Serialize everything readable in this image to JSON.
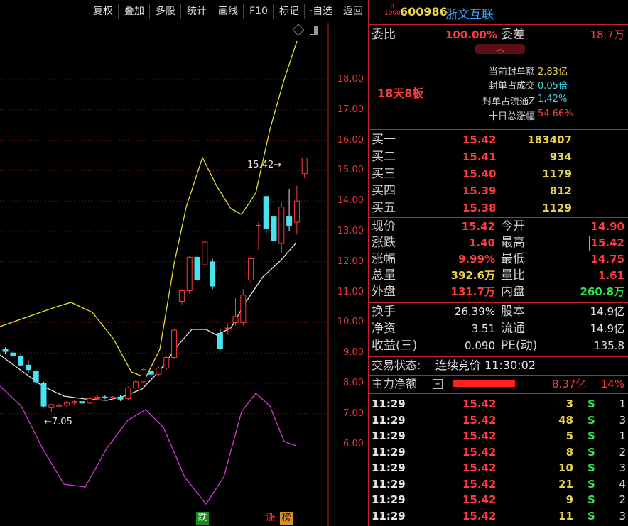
{
  "toolbar": {
    "buttons": [
      "复权",
      "叠加",
      "多股",
      "统计",
      "画线",
      "F10",
      "标记",
      "·自选",
      "返回"
    ]
  },
  "chart": {
    "price_ticks": [
      "18.00",
      "17.00",
      "16.00",
      "15.00",
      "14.00",
      "13.00",
      "12.00",
      "11.00",
      "10.00",
      "9.00",
      "8.00",
      "7.00",
      "6.00"
    ],
    "high_label": "15.42",
    "low_label": "7.05",
    "markers": {
      "down": "跌",
      "up": "涨",
      "rank": "榜"
    }
  },
  "header": {
    "badge_top": "R",
    "badge_bottom": "1000",
    "code": "600986",
    "name": "浙文互联"
  },
  "weibi": {
    "label1": "委比",
    "value1": "100.00%",
    "label2": "委差",
    "value2": "18.7万"
  },
  "seal": {
    "streak": "18天8板",
    "rows": [
      {
        "label": "当前封单额",
        "value": "2.83亿",
        "color": "yel"
      },
      {
        "label": "封单占成交",
        "value": "0.05倍",
        "color": "cyan"
      },
      {
        "label": "封单占流通Z",
        "value": "1.42%",
        "color": "cyan"
      },
      {
        "label": "十日总涨幅",
        "value": "54.66%",
        "color": "red"
      }
    ]
  },
  "bids": [
    {
      "label": "买一",
      "price": "15.42",
      "vol": "183407"
    },
    {
      "label": "买二",
      "price": "15.41",
      "vol": "934"
    },
    {
      "label": "买三",
      "price": "15.40",
      "vol": "1179"
    },
    {
      "label": "买四",
      "price": "15.39",
      "vol": "812"
    },
    {
      "label": "买五",
      "price": "15.38",
      "vol": "1129"
    }
  ],
  "quote": {
    "rows": [
      {
        "l1": "现价",
        "v1": "15.42",
        "c1": "red",
        "l2": "今开",
        "v2": "14.90",
        "c2": "red"
      },
      {
        "l1": "涨跌",
        "v1": "1.40",
        "c1": "red",
        "l2": "最高",
        "v2": "15.42",
        "c2": "red"
      },
      {
        "l1": "涨幅",
        "v1": "9.99%",
        "c1": "red",
        "l2": "最低",
        "v2": "14.75",
        "c2": "red"
      },
      {
        "l1": "总量",
        "v1": "392.6万",
        "c1": "yel",
        "l2": "量比",
        "v2": "1.61",
        "c2": "red"
      },
      {
        "l1": "外盘",
        "v1": "131.7万",
        "c1": "red",
        "l2": "内盘",
        "v2": "260.8万",
        "c2": "grn"
      }
    ]
  },
  "fund": {
    "rows": [
      {
        "l1": "换手",
        "v1": "26.39%",
        "l2": "股本",
        "v2": "14.9亿"
      },
      {
        "l1": "净资",
        "v1": "3.51",
        "l2": "流通",
        "v2": "14.9亿"
      },
      {
        "l1": "收益(三)",
        "v1": "0.090",
        "l2": "PE(动)",
        "v2": "135.8"
      }
    ]
  },
  "trade_status": {
    "label": "交易状态:",
    "value": "连续竞价 11:30:02"
  },
  "main_flow": {
    "label": "主力净额",
    "value": "8.37亿",
    "pct": "14%"
  },
  "ticks": [
    {
      "time": "11:29",
      "price": "15.42",
      "vol": "3",
      "side": "S",
      "n": "1"
    },
    {
      "time": "11:29",
      "price": "15.42",
      "vol": "48",
      "side": "S",
      "n": "3"
    },
    {
      "time": "11:29",
      "price": "15.42",
      "vol": "5",
      "side": "S",
      "n": "1"
    },
    {
      "time": "11:29",
      "price": "15.42",
      "vol": "8",
      "side": "S",
      "n": "2"
    },
    {
      "time": "11:29",
      "price": "15.42",
      "vol": "10",
      "side": "S",
      "n": "3"
    },
    {
      "time": "11:29",
      "price": "15.42",
      "vol": "21",
      "side": "S",
      "n": "4"
    },
    {
      "time": "11:29",
      "price": "15.42",
      "vol": "9",
      "side": "S",
      "n": "2"
    },
    {
      "time": "11:29",
      "price": "15.42",
      "vol": "11",
      "side": "S",
      "n": "3"
    }
  ],
  "candles": [
    {
      "o": 9.12,
      "c": 9.05,
      "h": 9.18,
      "l": 8.98
    },
    {
      "o": 9.0,
      "c": 8.92,
      "h": 9.05,
      "l": 8.85
    },
    {
      "o": 8.9,
      "c": 8.6,
      "h": 8.95,
      "l": 8.55
    },
    {
      "o": 8.6,
      "c": 8.45,
      "h": 8.75,
      "l": 8.35
    },
    {
      "o": 8.4,
      "c": 8.05,
      "h": 8.45,
      "l": 7.95
    },
    {
      "o": 8.0,
      "c": 7.25,
      "h": 8.05,
      "l": 7.2
    },
    {
      "o": 7.2,
      "c": 7.3,
      "h": 7.32,
      "l": 7.05
    },
    {
      "o": 7.25,
      "c": 7.28,
      "h": 7.33,
      "l": 7.2
    },
    {
      "o": 7.28,
      "c": 7.35,
      "h": 7.42,
      "l": 7.22
    },
    {
      "o": 7.35,
      "c": 7.4,
      "h": 7.45,
      "l": 7.3
    },
    {
      "o": 7.4,
      "c": 7.35,
      "h": 7.45,
      "l": 7.28
    },
    {
      "o": 7.35,
      "c": 7.5,
      "h": 7.55,
      "l": 7.3
    },
    {
      "o": 7.5,
      "c": 7.55,
      "h": 7.6,
      "l": 7.45
    },
    {
      "o": 7.55,
      "c": 7.52,
      "h": 7.6,
      "l": 7.48
    },
    {
      "o": 7.52,
      "c": 7.55,
      "h": 7.58,
      "l": 7.48
    },
    {
      "o": 7.55,
      "c": 7.48,
      "h": 7.6,
      "l": 7.42
    },
    {
      "o": 7.5,
      "c": 7.85,
      "h": 7.9,
      "l": 7.45
    },
    {
      "o": 7.85,
      "c": 8.05,
      "h": 8.1,
      "l": 7.8
    },
    {
      "o": 8.05,
      "c": 8.45,
      "h": 8.5,
      "l": 8.0
    },
    {
      "o": 8.4,
      "c": 8.3,
      "h": 8.45,
      "l": 8.25
    },
    {
      "o": 8.3,
      "c": 8.5,
      "h": 8.55,
      "l": 8.25
    },
    {
      "o": 8.5,
      "c": 8.85,
      "h": 8.9,
      "l": 8.45
    },
    {
      "o": 8.85,
      "c": 9.75,
      "h": 9.8,
      "l": 8.8
    },
    {
      "o": 10.7,
      "c": 11.05,
      "h": 11.1,
      "l": 10.6
    },
    {
      "o": 11.05,
      "c": 12.15,
      "h": 12.2,
      "l": 10.95
    },
    {
      "o": 12.15,
      "c": 11.4,
      "h": 12.2,
      "l": 11.2
    },
    {
      "o": 11.9,
      "c": 12.65,
      "h": 12.7,
      "l": 11.8
    },
    {
      "o": 12.0,
      "c": 11.2,
      "h": 12.1,
      "l": 11.1
    },
    {
      "o": 9.65,
      "c": 9.15,
      "h": 9.8,
      "l": 9.1
    },
    {
      "o": 9.82,
      "c": 9.82,
      "h": 9.95,
      "l": 9.6
    },
    {
      "o": 10.0,
      "c": 10.2,
      "h": 10.8,
      "l": 9.9
    },
    {
      "o": 10.0,
      "c": 10.9,
      "h": 11.1,
      "l": 9.9
    },
    {
      "o": 11.4,
      "c": 12.1,
      "h": 12.2,
      "l": 11.3
    },
    {
      "o": 13.2,
      "c": 13.2,
      "h": 13.3,
      "l": 12.4
    },
    {
      "o": 14.15,
      "c": 13.1,
      "h": 14.2,
      "l": 12.9
    },
    {
      "o": 13.5,
      "c": 12.7,
      "h": 13.6,
      "l": 12.5
    },
    {
      "o": 12.6,
      "c": 13.8,
      "h": 13.95,
      "l": 12.3
    },
    {
      "o": 13.5,
      "c": 13.2,
      "h": 14.4,
      "l": 13.0
    },
    {
      "o": 13.3,
      "c": 14.0,
      "h": 14.5,
      "l": 12.9
    },
    {
      "o": 14.9,
      "c": 15.42,
      "h": 15.42,
      "l": 14.75
    }
  ]
}
